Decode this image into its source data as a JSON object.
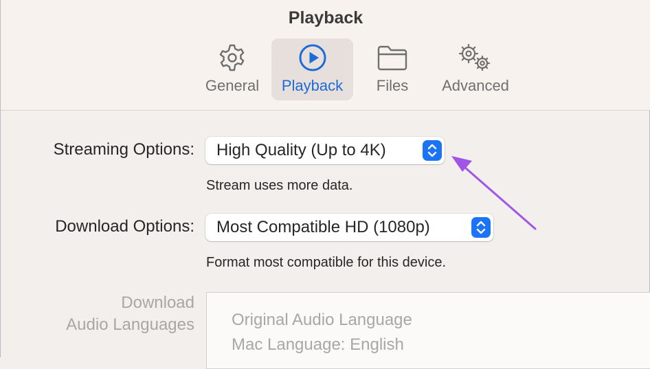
{
  "window": {
    "title": "Playback"
  },
  "tabs": [
    {
      "label": "General",
      "icon": "gear-icon",
      "active": false
    },
    {
      "label": "Playback",
      "icon": "play-circle-icon",
      "active": true
    },
    {
      "label": "Files",
      "icon": "folder-icon",
      "active": false
    },
    {
      "label": "Advanced",
      "icon": "gears-icon",
      "active": false
    }
  ],
  "streaming": {
    "label": "Streaming Options:",
    "value": "High Quality (Up to 4K)",
    "hint": "Stream uses more data."
  },
  "download": {
    "label": "Download Options:",
    "value": "Most Compatible HD (1080p)",
    "hint": "Format most compatible for this device."
  },
  "audio_languages": {
    "label_line1": "Download",
    "label_line2": "Audio Languages",
    "items": [
      "Original Audio Language",
      "Mac Language: English"
    ]
  },
  "colors": {
    "accent": "#1a74f5",
    "active_tab_text": "#1c6bd9",
    "annotation_arrow": "#a155e6"
  }
}
